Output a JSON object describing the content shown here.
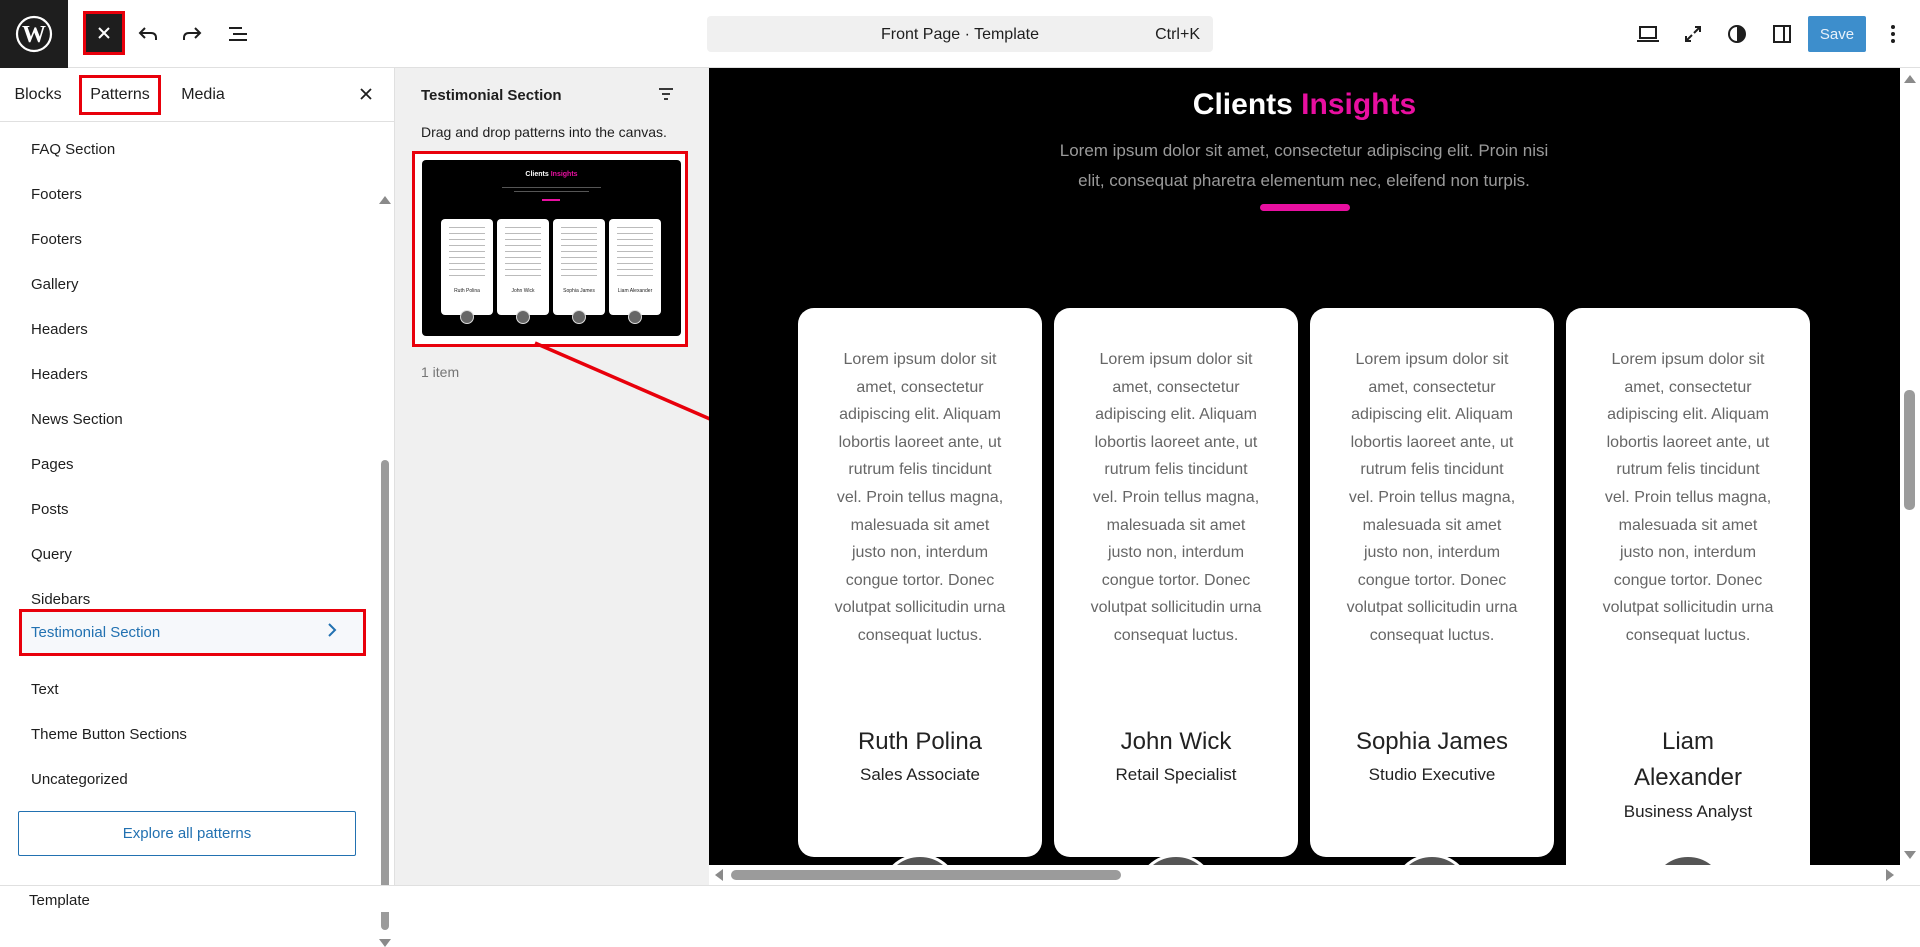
{
  "topbar": {
    "document_title": "Front Page · Template",
    "shortcut": "Ctrl+K",
    "save_label": "Save"
  },
  "inserter": {
    "tabs": [
      {
        "label": "Blocks"
      },
      {
        "label": "Patterns"
      },
      {
        "label": "Media"
      }
    ],
    "active_tab": "Patterns",
    "categories": [
      "FAQ Section",
      "Footers",
      "Footers",
      "Gallery",
      "Headers",
      "Headers",
      "News Section",
      "Pages",
      "Posts",
      "Query",
      "Sidebars",
      "Testimonial Section",
      "Text",
      "Theme Button Sections",
      "Uncategorized"
    ],
    "active_category": "Testimonial Section",
    "explore_label": "Explore all patterns"
  },
  "pattern_panel": {
    "title": "Testimonial Section",
    "hint": "Drag and drop patterns into the canvas.",
    "count": "1 item",
    "preview": {
      "title_white": "Clients",
      "title_accent": "Insights",
      "names": [
        "Ruth Polina",
        "John Wick",
        "Sophia James",
        "Liam Alexander"
      ]
    }
  },
  "canvas": {
    "title_white": "Clients",
    "title_accent": "Insights",
    "subtitle": "Lorem ipsum dolor sit amet, consectetur adipiscing elit. Proin nisi elit, consequat pharetra elementum nec, eleifend non turpis.",
    "accent_color": "#e80fa0",
    "cards": [
      {
        "text": "Lorem ipsum dolor sit amet, consectetur adipiscing elit. Aliquam lobortis laoreet ante, ut rutrum felis tincidunt vel. Proin tellus magna, malesuada sit amet justo non, interdum congue tortor. Donec volutpat sollicitudin urna consequat luctus.",
        "name": "Ruth Polina",
        "role": "Sales Associate"
      },
      {
        "text": "Lorem ipsum dolor sit amet, consectetur adipiscing elit. Aliquam lobortis laoreet ante, ut rutrum felis tincidunt vel. Proin tellus magna, malesuada sit amet justo non, interdum congue tortor. Donec volutpat sollicitudin urna consequat luctus.",
        "name": "John Wick",
        "role": "Retail Specialist"
      },
      {
        "text": "Lorem ipsum dolor sit amet, consectetur adipiscing elit. Aliquam lobortis laoreet ante, ut rutrum felis tincidunt vel. Proin tellus magna, malesuada sit amet justo non, interdum congue tortor. Donec volutpat sollicitudin urna consequat luctus.",
        "name": "Sophia James",
        "role": "Studio Executive"
      },
      {
        "text": "Lorem ipsum dolor sit amet, consectetur adipiscing elit. Aliquam lobortis laoreet ante, ut rutrum felis tincidunt vel. Proin tellus magna, malesuada sit amet justo non, interdum congue tortor. Donec volutpat sollicitudin urna consequat luctus.",
        "name": "Liam Alexander",
        "role": "Business Analyst"
      }
    ]
  },
  "footer": {
    "breadcrumb": "Template"
  },
  "icons": {
    "logo": "wordpress-logo-icon",
    "close": "close-icon",
    "undo": "undo-icon",
    "redo": "redo-icon",
    "list_view": "list-view-icon",
    "device_preview": "laptop-icon",
    "fullscreen": "expand-icon",
    "styles": "contrast-icon",
    "settings": "sidebar-icon",
    "options": "kebab-menu-icon",
    "filter": "filter-icon",
    "chevron": "chevron-right-icon"
  },
  "colors": {
    "highlight": "#e8000b",
    "link": "#2271b1",
    "save": "#3d8ecc"
  }
}
